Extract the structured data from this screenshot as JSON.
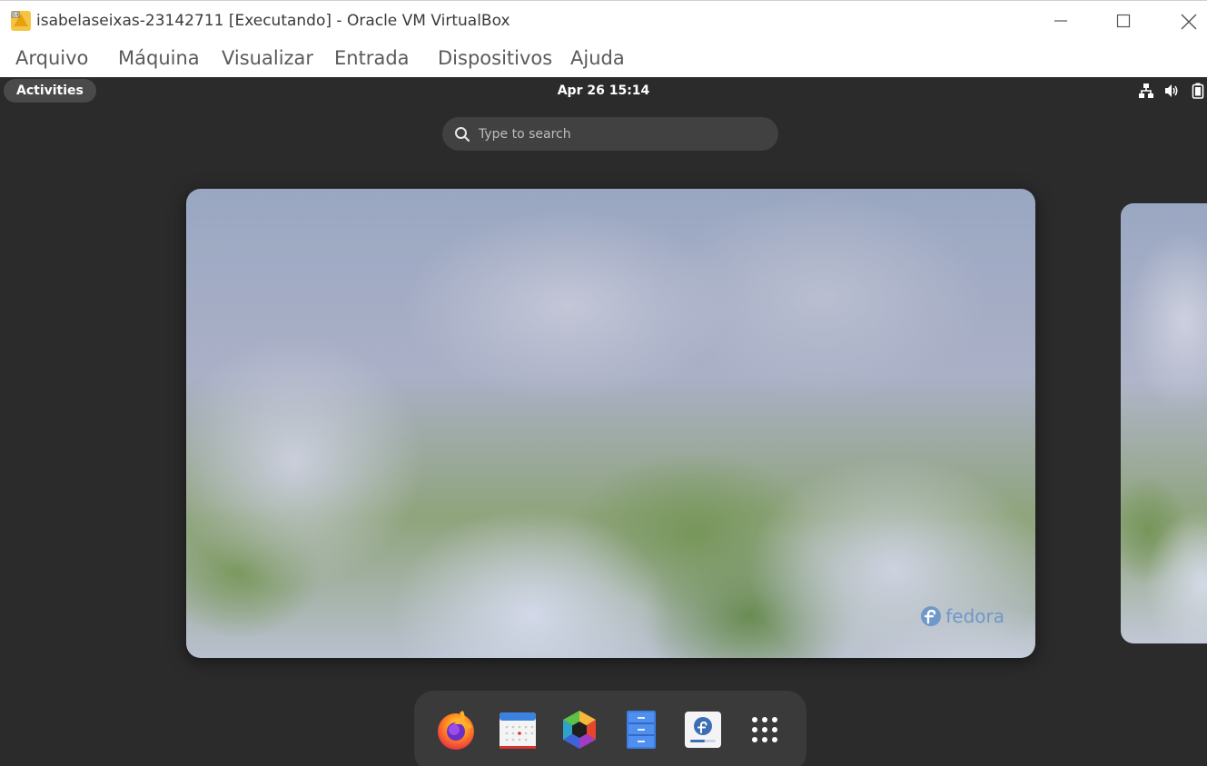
{
  "window": {
    "title": "isabelaseixas-23142711 [Executando] - Oracle VM VirtualBox",
    "icon": "virtualbox-icon",
    "controls": [
      "minimize-icon",
      "maximize-icon",
      "close-icon"
    ]
  },
  "menubar": {
    "items": [
      "Arquivo",
      "Máquina",
      "Visualizar",
      "Entrada",
      "Dispositivos",
      "Ajuda"
    ]
  },
  "gnome": {
    "activities_label": "Activities",
    "clock": "Apr 26  15:14",
    "system_icons": [
      "network-wired-icon",
      "volume-icon",
      "battery-icon"
    ],
    "search": {
      "placeholder": "Type to search",
      "value": ""
    },
    "wallpaper_brand": "fedora",
    "dock": {
      "apps": [
        "firefox-icon",
        "calendar-icon",
        "photos-icon",
        "file-cabinet-icon",
        "fedora-software-icon",
        "show-apps-grid-icon"
      ]
    }
  },
  "colors": {
    "guest_background": "#2b2b2b",
    "panel_pill": "#4a4a4a",
    "fedora_blue": "#6f97c8"
  }
}
